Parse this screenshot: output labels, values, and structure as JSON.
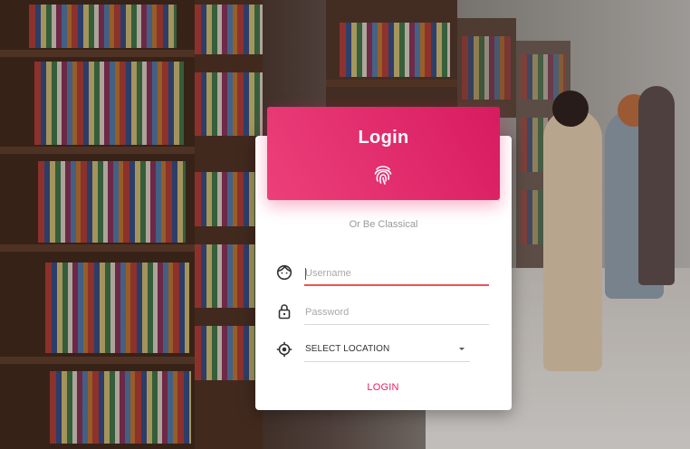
{
  "card": {
    "title": "Login",
    "subtitle": "Or Be Classical",
    "fingerprint_icon": "fingerprint-icon"
  },
  "form": {
    "username": {
      "placeholder": "Username",
      "value": "",
      "icon": "face-icon"
    },
    "password": {
      "placeholder": "Password",
      "value": "",
      "icon": "lock-icon"
    },
    "location": {
      "selected": "SELECT LOCATION",
      "icon": "location-target-icon"
    },
    "submit_label": "LOGIN"
  },
  "colors": {
    "accent": "#e91e63",
    "header_gradient_start": "#ec407a",
    "header_gradient_end": "#d81b60",
    "active_underline": "#ef5350",
    "subtitle": "#9a9a9a"
  }
}
